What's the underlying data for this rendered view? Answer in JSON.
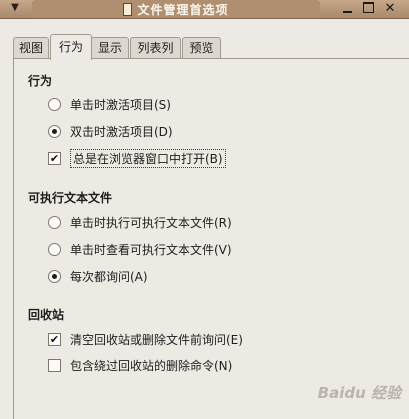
{
  "window": {
    "title": "文件管理首选项",
    "menu_icon": "chevron-down-icon",
    "controls": {
      "minimize": "minimize-icon",
      "maximize": "maximize-icon",
      "close": "close-icon",
      "close_glyph": "✕"
    }
  },
  "tabs": [
    {
      "label": "视图",
      "active": false
    },
    {
      "label": "行为",
      "active": true
    },
    {
      "label": "显示",
      "active": false
    },
    {
      "label": "列表列",
      "active": false
    },
    {
      "label": "预览",
      "active": false
    }
  ],
  "sections": {
    "behavior": {
      "title": "行为",
      "options": [
        {
          "type": "radio",
          "label": "单击时激活项目(S)",
          "selected": false
        },
        {
          "type": "radio",
          "label": "双击时激活项目(D)",
          "selected": true
        },
        {
          "type": "checkbox",
          "label": "总是在浏览器窗口中打开(B)",
          "checked": true
        }
      ]
    },
    "executable": {
      "title": "可执行文本文件",
      "options": [
        {
          "type": "radio",
          "label": "单击时执行可执行文本文件(R)",
          "selected": false
        },
        {
          "type": "radio",
          "label": "单击时查看可执行文本文件(V)",
          "selected": false
        },
        {
          "type": "radio",
          "label": "每次都询问(A)",
          "selected": true
        }
      ]
    },
    "trash": {
      "title": "回收站",
      "options": [
        {
          "type": "checkbox",
          "label": "清空回收站或删除文件前询问(E)",
          "checked": true
        },
        {
          "type": "checkbox",
          "label": "包含绕过回收站的删除命令(N)",
          "checked": false
        }
      ]
    }
  },
  "watermark": "Baidu 经验",
  "colors": {
    "titlebar": "#b08f70",
    "window_bg": "#ede9e3"
  }
}
